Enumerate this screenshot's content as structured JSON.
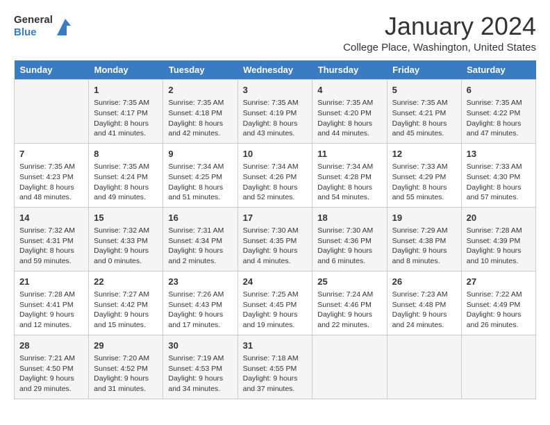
{
  "header": {
    "logo_line1": "General",
    "logo_line2": "Blue",
    "title": "January 2024",
    "subtitle": "College Place, Washington, United States"
  },
  "weekdays": [
    "Sunday",
    "Monday",
    "Tuesday",
    "Wednesday",
    "Thursday",
    "Friday",
    "Saturday"
  ],
  "weeks": [
    [
      {
        "day": "",
        "info": ""
      },
      {
        "day": "1",
        "info": "Sunrise: 7:35 AM\nSunset: 4:17 PM\nDaylight: 8 hours\nand 41 minutes."
      },
      {
        "day": "2",
        "info": "Sunrise: 7:35 AM\nSunset: 4:18 PM\nDaylight: 8 hours\nand 42 minutes."
      },
      {
        "day": "3",
        "info": "Sunrise: 7:35 AM\nSunset: 4:19 PM\nDaylight: 8 hours\nand 43 minutes."
      },
      {
        "day": "4",
        "info": "Sunrise: 7:35 AM\nSunset: 4:20 PM\nDaylight: 8 hours\nand 44 minutes."
      },
      {
        "day": "5",
        "info": "Sunrise: 7:35 AM\nSunset: 4:21 PM\nDaylight: 8 hours\nand 45 minutes."
      },
      {
        "day": "6",
        "info": "Sunrise: 7:35 AM\nSunset: 4:22 PM\nDaylight: 8 hours\nand 47 minutes."
      }
    ],
    [
      {
        "day": "7",
        "info": "Sunrise: 7:35 AM\nSunset: 4:23 PM\nDaylight: 8 hours\nand 48 minutes."
      },
      {
        "day": "8",
        "info": "Sunrise: 7:35 AM\nSunset: 4:24 PM\nDaylight: 8 hours\nand 49 minutes."
      },
      {
        "day": "9",
        "info": "Sunrise: 7:34 AM\nSunset: 4:25 PM\nDaylight: 8 hours\nand 51 minutes."
      },
      {
        "day": "10",
        "info": "Sunrise: 7:34 AM\nSunset: 4:26 PM\nDaylight: 8 hours\nand 52 minutes."
      },
      {
        "day": "11",
        "info": "Sunrise: 7:34 AM\nSunset: 4:28 PM\nDaylight: 8 hours\nand 54 minutes."
      },
      {
        "day": "12",
        "info": "Sunrise: 7:33 AM\nSunset: 4:29 PM\nDaylight: 8 hours\nand 55 minutes."
      },
      {
        "day": "13",
        "info": "Sunrise: 7:33 AM\nSunset: 4:30 PM\nDaylight: 8 hours\nand 57 minutes."
      }
    ],
    [
      {
        "day": "14",
        "info": "Sunrise: 7:32 AM\nSunset: 4:31 PM\nDaylight: 8 hours\nand 59 minutes."
      },
      {
        "day": "15",
        "info": "Sunrise: 7:32 AM\nSunset: 4:33 PM\nDaylight: 9 hours\nand 0 minutes."
      },
      {
        "day": "16",
        "info": "Sunrise: 7:31 AM\nSunset: 4:34 PM\nDaylight: 9 hours\nand 2 minutes."
      },
      {
        "day": "17",
        "info": "Sunrise: 7:30 AM\nSunset: 4:35 PM\nDaylight: 9 hours\nand 4 minutes."
      },
      {
        "day": "18",
        "info": "Sunrise: 7:30 AM\nSunset: 4:36 PM\nDaylight: 9 hours\nand 6 minutes."
      },
      {
        "day": "19",
        "info": "Sunrise: 7:29 AM\nSunset: 4:38 PM\nDaylight: 9 hours\nand 8 minutes."
      },
      {
        "day": "20",
        "info": "Sunrise: 7:28 AM\nSunset: 4:39 PM\nDaylight: 9 hours\nand 10 minutes."
      }
    ],
    [
      {
        "day": "21",
        "info": "Sunrise: 7:28 AM\nSunset: 4:41 PM\nDaylight: 9 hours\nand 12 minutes."
      },
      {
        "day": "22",
        "info": "Sunrise: 7:27 AM\nSunset: 4:42 PM\nDaylight: 9 hours\nand 15 minutes."
      },
      {
        "day": "23",
        "info": "Sunrise: 7:26 AM\nSunset: 4:43 PM\nDaylight: 9 hours\nand 17 minutes."
      },
      {
        "day": "24",
        "info": "Sunrise: 7:25 AM\nSunset: 4:45 PM\nDaylight: 9 hours\nand 19 minutes."
      },
      {
        "day": "25",
        "info": "Sunrise: 7:24 AM\nSunset: 4:46 PM\nDaylight: 9 hours\nand 22 minutes."
      },
      {
        "day": "26",
        "info": "Sunrise: 7:23 AM\nSunset: 4:48 PM\nDaylight: 9 hours\nand 24 minutes."
      },
      {
        "day": "27",
        "info": "Sunrise: 7:22 AM\nSunset: 4:49 PM\nDaylight: 9 hours\nand 26 minutes."
      }
    ],
    [
      {
        "day": "28",
        "info": "Sunrise: 7:21 AM\nSunset: 4:50 PM\nDaylight: 9 hours\nand 29 minutes."
      },
      {
        "day": "29",
        "info": "Sunrise: 7:20 AM\nSunset: 4:52 PM\nDaylight: 9 hours\nand 31 minutes."
      },
      {
        "day": "30",
        "info": "Sunrise: 7:19 AM\nSunset: 4:53 PM\nDaylight: 9 hours\nand 34 minutes."
      },
      {
        "day": "31",
        "info": "Sunrise: 7:18 AM\nSunset: 4:55 PM\nDaylight: 9 hours\nand 37 minutes."
      },
      {
        "day": "",
        "info": ""
      },
      {
        "day": "",
        "info": ""
      },
      {
        "day": "",
        "info": ""
      }
    ]
  ]
}
